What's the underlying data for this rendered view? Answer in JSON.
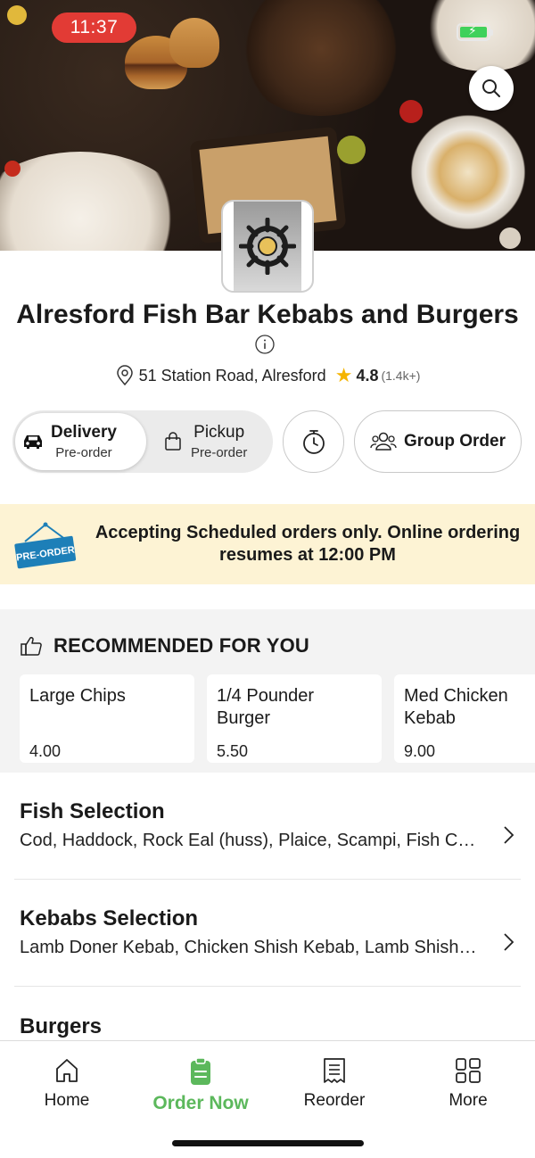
{
  "status_bar": {
    "time": "11:37"
  },
  "restaurant": {
    "name": "Alresford Fish Bar Kebabs and Burgers",
    "address": "51 Station Road, Alresford",
    "rating": "4.8",
    "rating_count": "(1.4k+)"
  },
  "modes": {
    "delivery": {
      "label": "Delivery",
      "sub": "Pre-order"
    },
    "pickup": {
      "label": "Pickup",
      "sub": "Pre-order"
    },
    "group_order": "Group Order"
  },
  "banner": {
    "badge": "PRE-ORDER",
    "message": "Accepting Scheduled orders only. Online ordering resumes at 12:00 PM"
  },
  "recommended": {
    "title": "RECOMMENDED FOR YOU",
    "items": [
      {
        "name": "Large Chips",
        "price": "4.00"
      },
      {
        "name": "1/4 Pounder Burger",
        "price": "5.50"
      },
      {
        "name": "Med Chicken Kebab",
        "price": "9.00"
      }
    ]
  },
  "categories": [
    {
      "name": "Fish Selection",
      "desc": "Cod, Haddock, Rock Eal (huss), Plaice, Scampi, Fish Ca…"
    },
    {
      "name": "Kebabs Selection",
      "desc": "Lamb Doner Kebab, Chicken Shish Kebab, Lamb Shish…"
    },
    {
      "name": "Burgers",
      "desc": ""
    }
  ],
  "nav": {
    "home": "Home",
    "order_now": "Order Now",
    "reorder": "Reorder",
    "more": "More"
  },
  "colors": {
    "accent_green": "#5cb85c",
    "status_red": "#e23b35",
    "banner_bg": "#fdf3d4",
    "star": "#f5b400",
    "badge_blue": "#1d7fb8"
  }
}
